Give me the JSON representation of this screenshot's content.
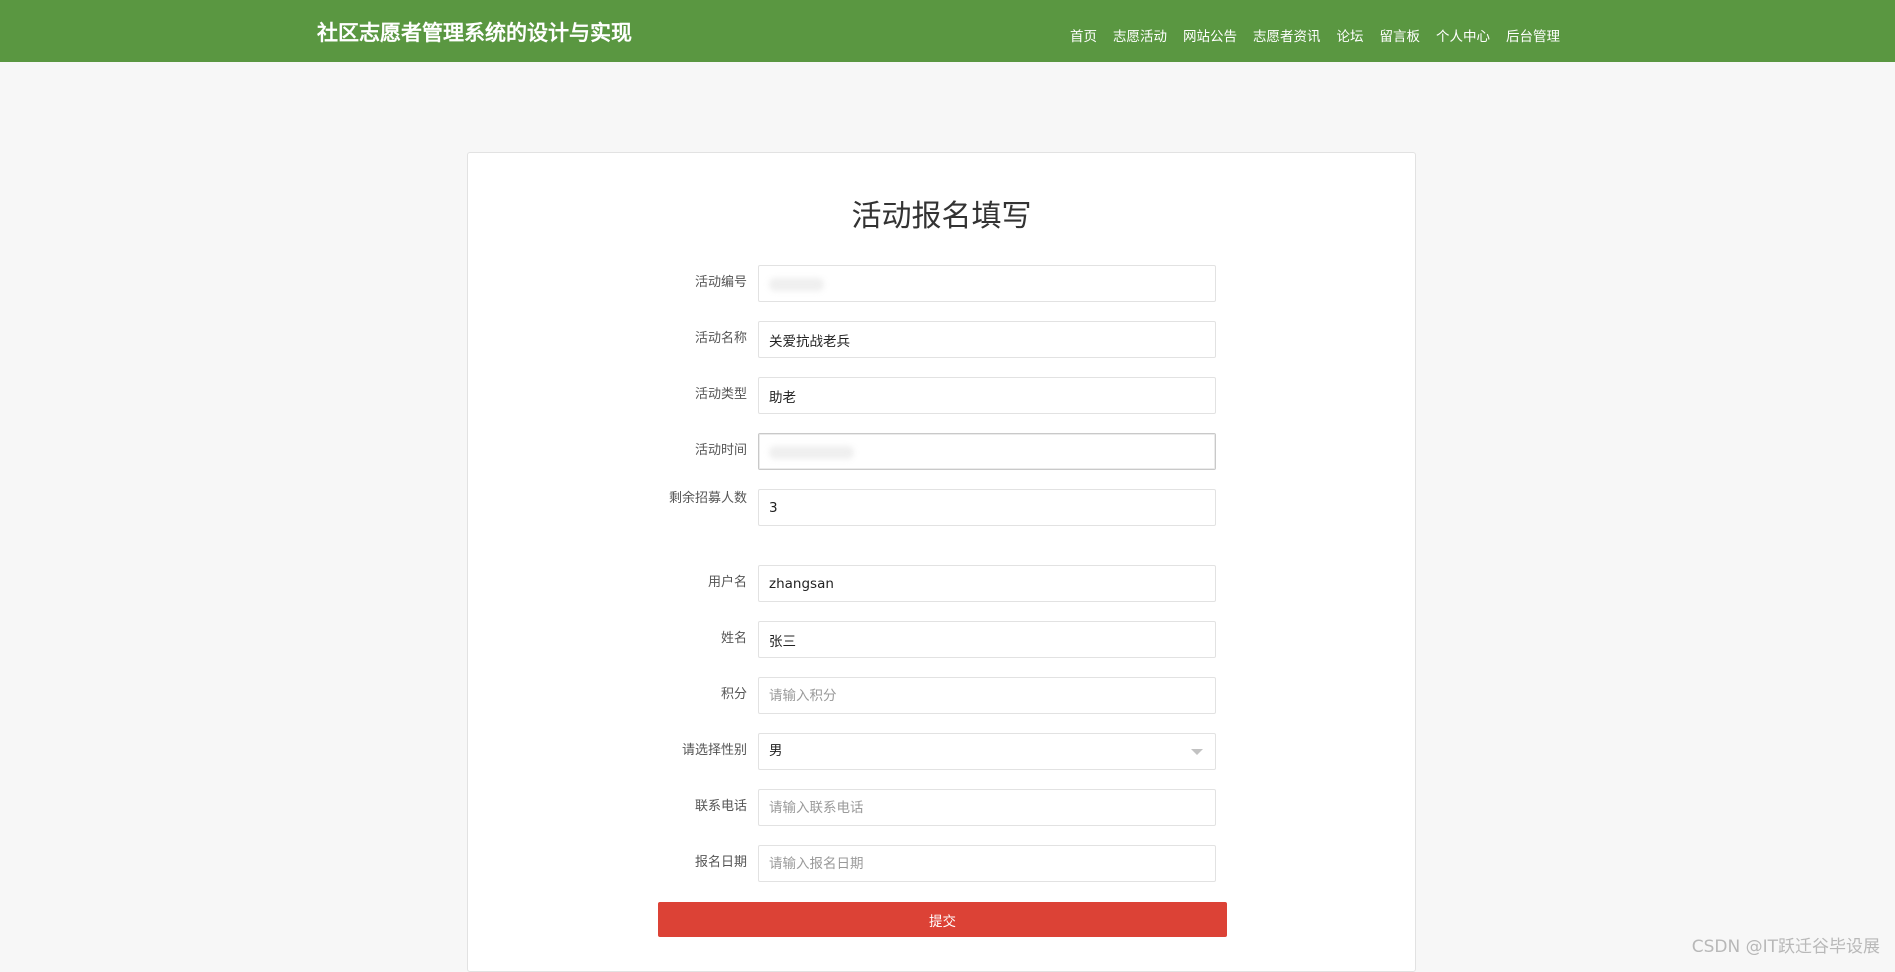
{
  "header": {
    "site_title": "社区志愿者管理系统的设计与实现",
    "nav": [
      "首页",
      "志愿活动",
      "网站公告",
      "志愿者资讯",
      "论坛",
      "留言板",
      "个人中心",
      "后台管理"
    ]
  },
  "form": {
    "title": "活动报名填写",
    "fields": [
      {
        "label": "活动编号",
        "value": ""
      },
      {
        "label": "活动名称",
        "value": "关爱抗战老兵"
      },
      {
        "label": "活动类型",
        "value": "助老"
      },
      {
        "label": "活动时间",
        "value": ""
      },
      {
        "label": "剩余招募人数",
        "value": "3"
      },
      {
        "label": "用户名",
        "value": "zhangsan"
      },
      {
        "label": "姓名",
        "value": "张三"
      },
      {
        "label": "积分",
        "value": "",
        "placeholder": "请输入积分"
      },
      {
        "label": "请选择性别",
        "value": "男"
      },
      {
        "label": "联系电话",
        "value": "",
        "placeholder": "请输入联系电话"
      },
      {
        "label": "报名日期",
        "value": "",
        "placeholder": "请输入报名日期"
      }
    ],
    "submit_label": "提交"
  },
  "watermark": "CSDN @IT跃迁谷毕设展",
  "colors": {
    "header_bg": "#5a9741",
    "submit_bg": "#dc4236",
    "page_bg": "#f7f7f7"
  }
}
